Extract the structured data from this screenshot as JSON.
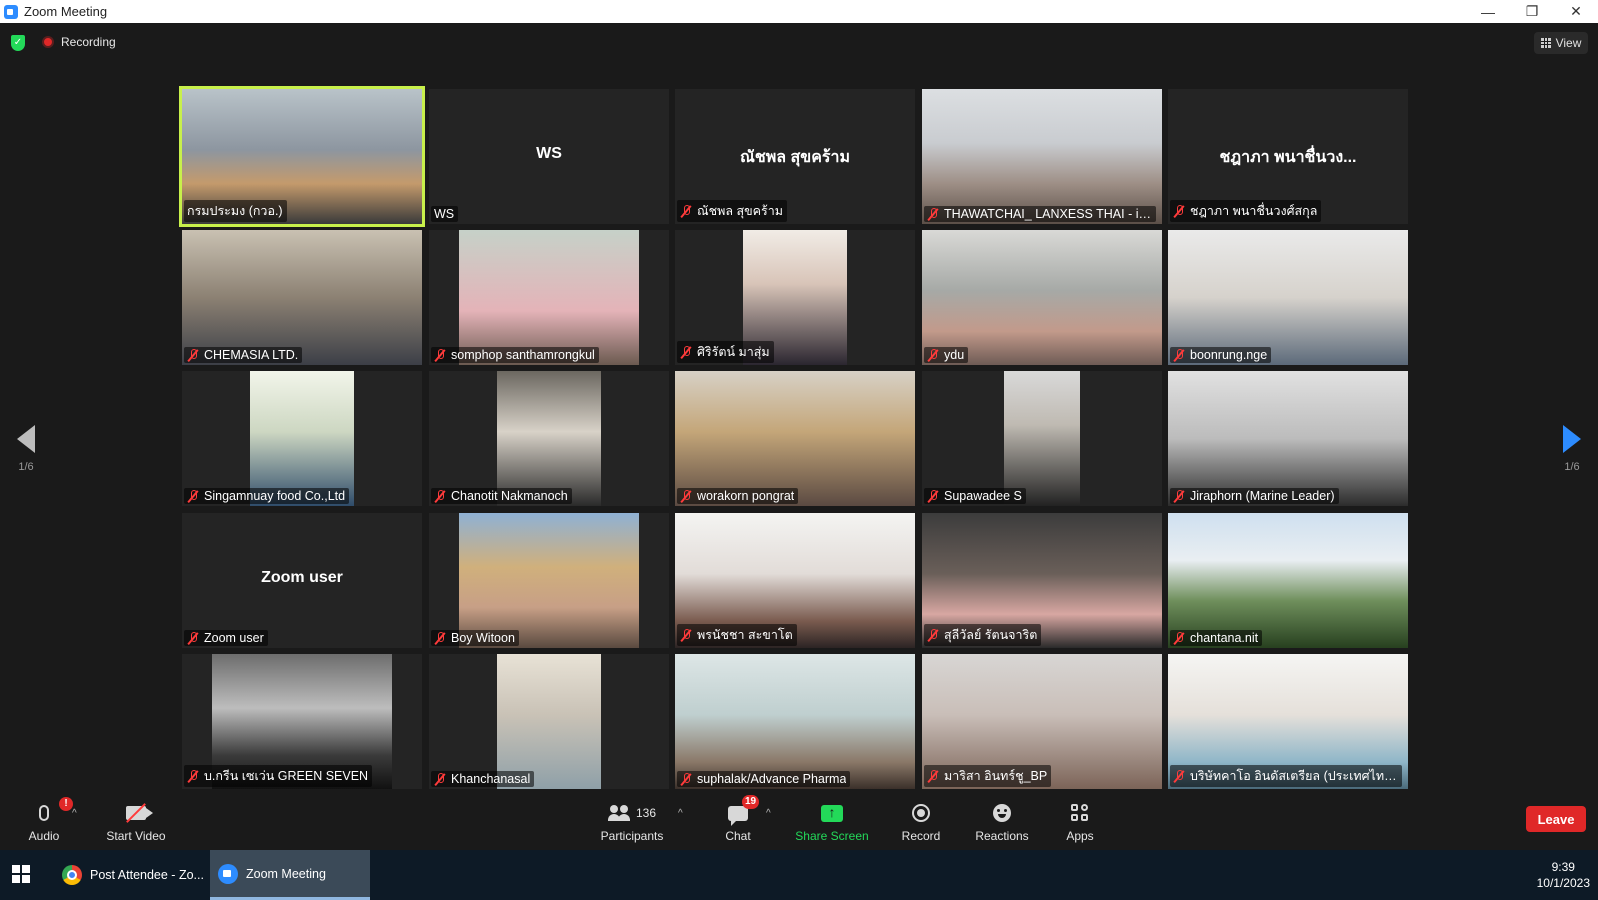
{
  "window": {
    "title": "Zoom Meeting",
    "minimize": "—",
    "restore": "❐",
    "close": "✕"
  },
  "top": {
    "recording_label": "Recording",
    "view_label": "View"
  },
  "pager": {
    "left_page": "1/6",
    "right_page": "1/6"
  },
  "tiles": [
    {
      "name": "กรมประมง (กวอ.)",
      "muted": false,
      "active": true,
      "video": true,
      "initials": ""
    },
    {
      "name": "WS",
      "muted": false,
      "active": false,
      "video": false,
      "initials": "WS"
    },
    {
      "name": "ณัชพล สุขคร้าม",
      "muted": true,
      "active": false,
      "video": false,
      "initials": "ณัชพล สุขคร้าม"
    },
    {
      "name": "THAWATCHAI_ LANXESS THAI - iPad...",
      "muted": true,
      "active": false,
      "video": true,
      "initials": ""
    },
    {
      "name": "ชฎาภา พนาชื่นวงศ์สกุล",
      "muted": true,
      "active": false,
      "video": false,
      "initials": "ชฎาภา พนาชื่นวง..."
    },
    {
      "name": "CHEMASIA LTD.",
      "muted": true,
      "active": false,
      "video": true,
      "initials": ""
    },
    {
      "name": "somphop santhamrongkul",
      "muted": true,
      "active": false,
      "video": true,
      "initials": ""
    },
    {
      "name": "ศิริรัตน์ มาสุ่ม",
      "muted": true,
      "active": false,
      "video": true,
      "initials": ""
    },
    {
      "name": "ydu",
      "muted": true,
      "active": false,
      "video": true,
      "initials": ""
    },
    {
      "name": "boonrung.nge",
      "muted": true,
      "active": false,
      "video": true,
      "initials": ""
    },
    {
      "name": "Singamnuay food Co.,Ltd",
      "muted": true,
      "active": false,
      "video": true,
      "initials": ""
    },
    {
      "name": "Chanotit Nakmanoch",
      "muted": true,
      "active": false,
      "video": true,
      "initials": ""
    },
    {
      "name": "worakorn pongrat",
      "muted": true,
      "active": false,
      "video": true,
      "initials": ""
    },
    {
      "name": "Supawadee S",
      "muted": true,
      "active": false,
      "video": true,
      "initials": ""
    },
    {
      "name": "Jiraphorn  (Marine Leader)",
      "muted": true,
      "active": false,
      "video": true,
      "initials": ""
    },
    {
      "name": "Zoom user",
      "muted": true,
      "active": false,
      "video": false,
      "initials": "Zoom user"
    },
    {
      "name": "Boy Witoon",
      "muted": true,
      "active": false,
      "video": true,
      "initials": ""
    },
    {
      "name": "พรนัชชา สะขาโต",
      "muted": true,
      "active": false,
      "video": true,
      "initials": ""
    },
    {
      "name": "สุลีวัลย์ รัตนจาริต",
      "muted": true,
      "active": false,
      "video": true,
      "initials": ""
    },
    {
      "name": "chantana.nit",
      "muted": true,
      "active": false,
      "video": true,
      "initials": ""
    },
    {
      "name": "บ.กรีน เซเว่น GREEN SEVEN",
      "muted": true,
      "active": false,
      "video": true,
      "initials": ""
    },
    {
      "name": "Khanchanasal",
      "muted": true,
      "active": false,
      "video": true,
      "initials": ""
    },
    {
      "name": "suphalak/Advance Pharma",
      "muted": true,
      "active": false,
      "video": true,
      "initials": ""
    },
    {
      "name": "มาริสา อินทร์ชู_BP",
      "muted": true,
      "active": false,
      "video": true,
      "initials": ""
    },
    {
      "name": "บริษัทคาโอ อินดัสเตรียล (ประเทศไทย) จำกัด",
      "muted": true,
      "active": false,
      "video": true,
      "initials": ""
    }
  ],
  "toolbar": {
    "audio": "Audio",
    "audio_badge": "!",
    "start_video": "Start Video",
    "participants": "Participants",
    "participants_count": "136",
    "chat": "Chat",
    "chat_badge": "19",
    "share_screen": "Share Screen",
    "record": "Record",
    "reactions": "Reactions",
    "apps": "Apps",
    "leave": "Leave"
  },
  "taskbar": {
    "chrome_task": "Post Attendee - Zo...",
    "zoom_task": "Zoom Meeting",
    "time": "9:39",
    "date": "10/1/2023"
  },
  "colors": {
    "background": "#1a1a1a",
    "tile": "#242424",
    "active_speaker": "#c8f04b",
    "muted_red": "#ff3b3b",
    "share_green": "#23d959",
    "leave_red": "#e02828",
    "accent_blue": "#2d8cff"
  }
}
